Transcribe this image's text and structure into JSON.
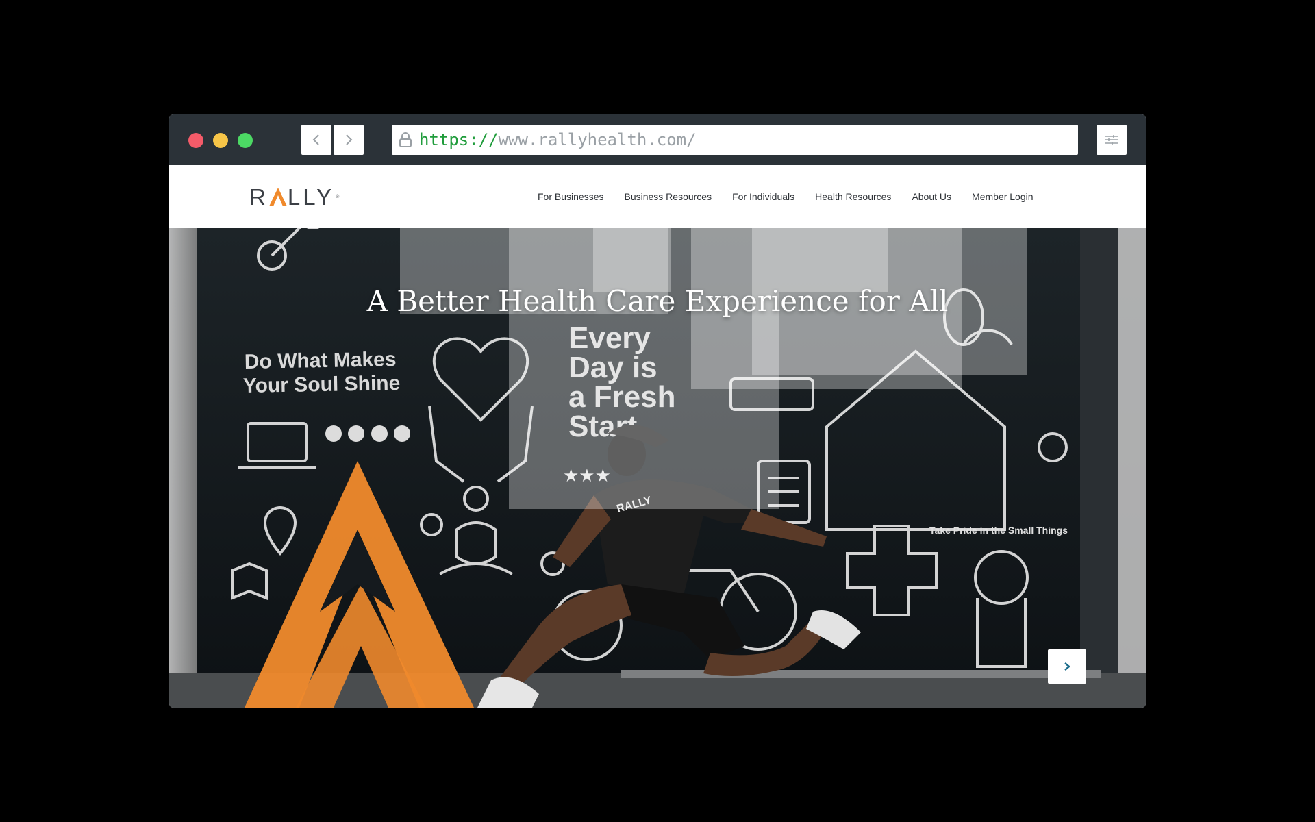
{
  "browser": {
    "url_scheme": "https://",
    "url_rest": "www.rallyhealth.com/"
  },
  "site": {
    "logo": {
      "before": "R",
      "after": "LLY",
      "tm": "®"
    },
    "nav": [
      {
        "label": "For Businesses"
      },
      {
        "label": "Business Resources"
      },
      {
        "label": "For Individuals"
      },
      {
        "label": "Health Resources"
      },
      {
        "label": "About Us"
      },
      {
        "label": "Member Login"
      }
    ]
  },
  "hero": {
    "headline": "A Better Health Care Experience for All",
    "mural_text_1": "Do What Makes",
    "mural_text_2": "Your Soul Shine",
    "mural_text_3": "Every",
    "mural_text_4": "Day is",
    "mural_text_5": "a Fresh",
    "mural_text_6": "Start",
    "mural_text_7": "Take Pride in the Small Things",
    "shirt_text": "RALLY"
  },
  "colors": {
    "brand_orange": "#f08a2c",
    "titlebar": "#2b3238"
  }
}
